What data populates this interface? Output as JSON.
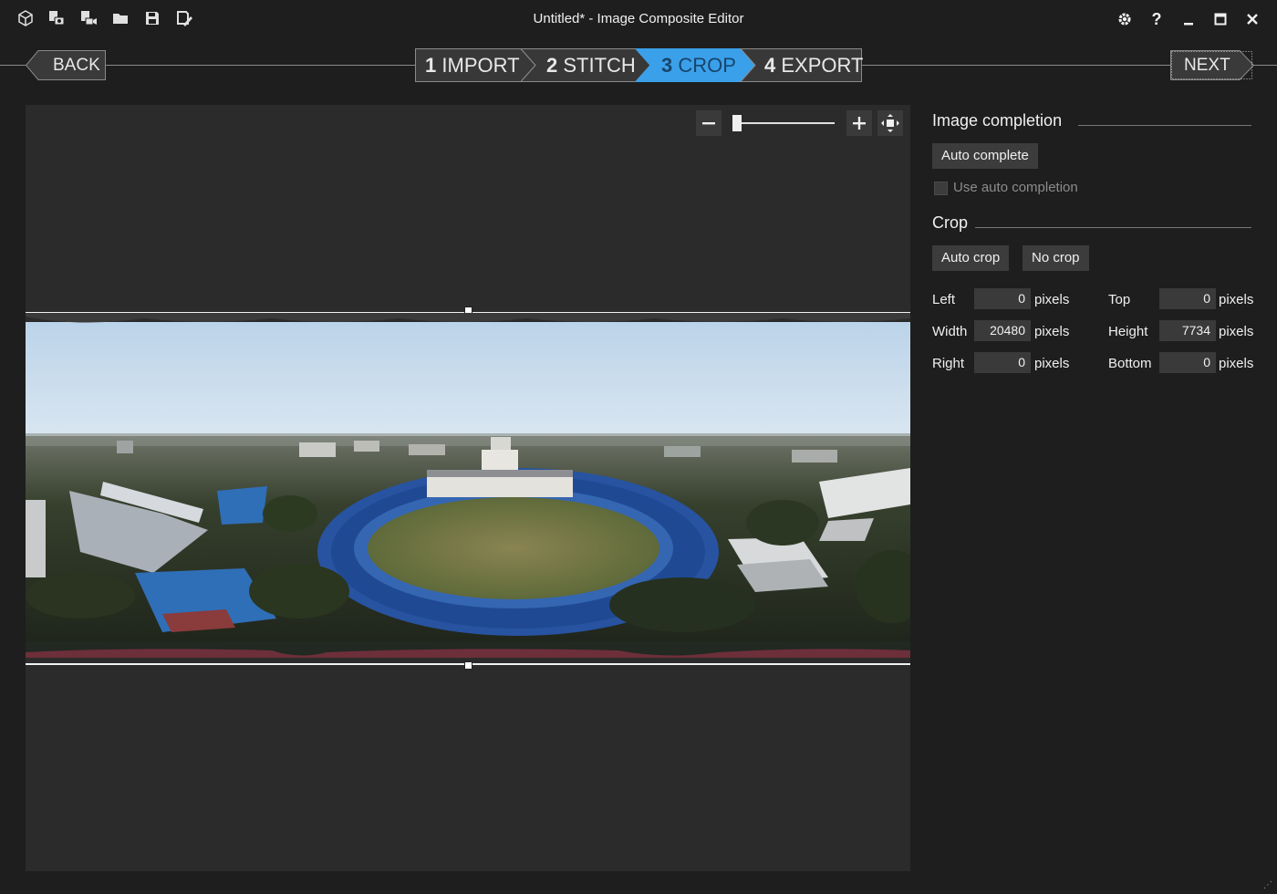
{
  "window": {
    "title": "Untitled* - Image Composite Editor"
  },
  "toolbar": {
    "icons": [
      "new-project-icon",
      "new-panorama-from-images-icon",
      "new-panorama-from-video-icon",
      "open-project-icon",
      "save-project-icon",
      "save-as-icon"
    ]
  },
  "window_controls": {
    "icons": [
      "settings-icon",
      "help-icon",
      "minimize-icon",
      "maximize-icon",
      "close-icon"
    ]
  },
  "nav": {
    "back_label": "BACK",
    "next_label": "NEXT",
    "steps": [
      {
        "number": "1",
        "label": "IMPORT",
        "active": false
      },
      {
        "number": "2",
        "label": "STITCH",
        "active": false
      },
      {
        "number": "3",
        "label": "CROP",
        "active": true
      },
      {
        "number": "4",
        "label": "EXPORT",
        "active": false
      }
    ]
  },
  "zoom": {
    "minus": "−",
    "plus": "+",
    "level_fraction": 0.05
  },
  "image_completion": {
    "title": "Image completion",
    "auto_complete_label": "Auto complete",
    "use_auto_completion_label": "Use auto completion",
    "use_auto_completion_checked": false
  },
  "crop": {
    "title": "Crop",
    "auto_crop_label": "Auto crop",
    "no_crop_label": "No crop",
    "unit": "pixels",
    "left_label": "Left",
    "left_value": "0",
    "top_label": "Top",
    "top_value": "0",
    "width_label": "Width",
    "width_value": "20480",
    "height_label": "Height",
    "height_value": "7734",
    "right_label": "Right",
    "right_value": "0",
    "bottom_label": "Bottom",
    "bottom_value": "0"
  },
  "colors": {
    "background": "#1e1e1e",
    "canvas": "#2b2b2b",
    "accent": "#3ba0ea",
    "button": "#3c3c3c"
  }
}
